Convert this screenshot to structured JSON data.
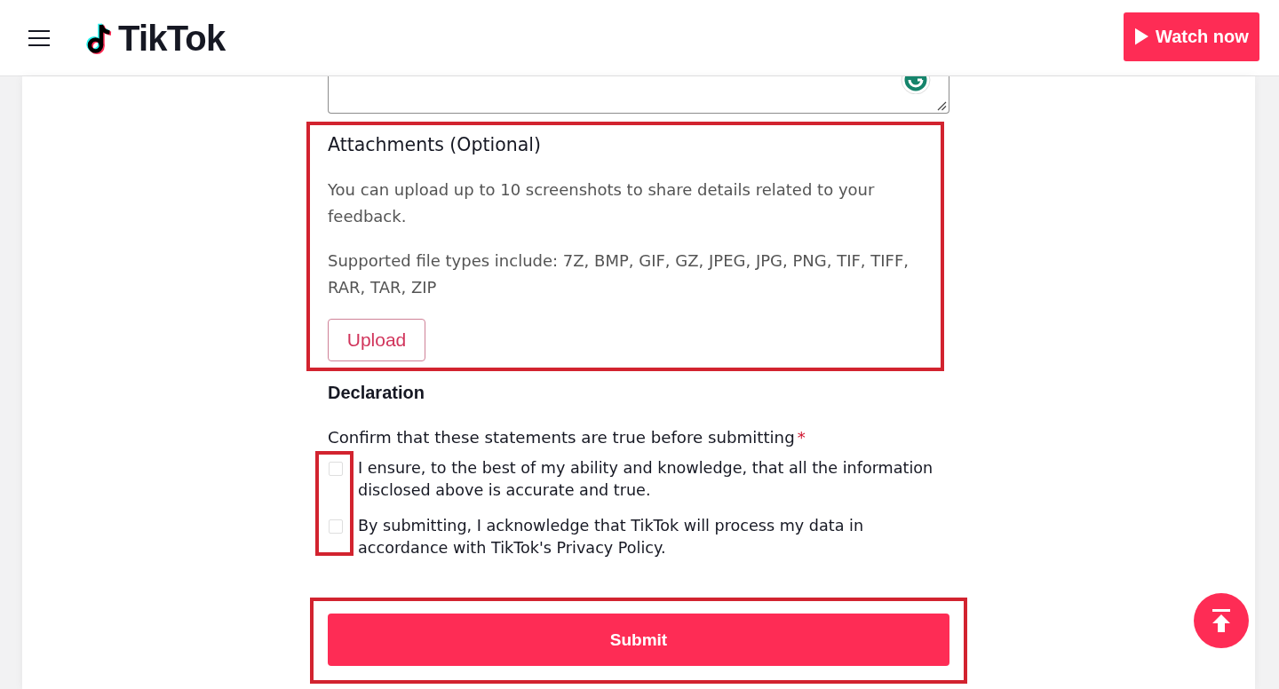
{
  "header": {
    "brand": "TikTok",
    "watch_button": "Watch now"
  },
  "attachments": {
    "title": "Attachments (Optional)",
    "highlighted": true,
    "notes": [
      "You can upload up to 10 screenshots to share details related to your feedback.",
      "Supported file types include: 7Z, BMP, GIF, GZ, JPEG, JPG, PNG, TIF, TIFF, RAR, TAR, ZIP"
    ],
    "upload_button": "Upload"
  },
  "declaration": {
    "title": "Declaration",
    "prompt": "Confirm that these statements are true before submitting",
    "required_mark": "*",
    "checkboxes_highlighted": true,
    "statements": [
      {
        "text": "I ensure, to the best of my ability and knowledge, that all the information disclosed above is accurate and true.",
        "checked": false
      },
      {
        "text": "By submitting, I acknowledge that TikTok will process my data in accordance with TikTok's Privacy Policy.",
        "checked": false
      }
    ]
  },
  "submit": {
    "label": "Submit",
    "highlighted": true
  }
}
